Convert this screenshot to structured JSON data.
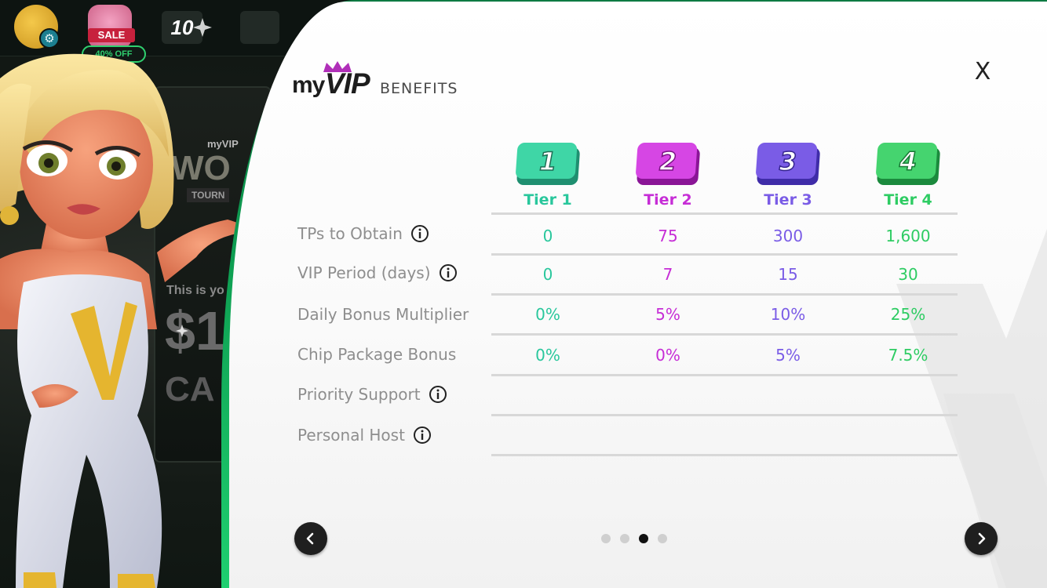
{
  "background": {
    "sale_tag": "SALE",
    "off_tag": "40% OFF",
    "level_badge": "10",
    "promo": {
      "myvip": "myVIP",
      "heading": "WO",
      "tournament": "TOURN",
      "this_is": "This is yo",
      "amount": "$1",
      "ca": "CA"
    }
  },
  "panel": {
    "logo": {
      "my": "my",
      "vip": "VIP",
      "benefits": "BENEFITS"
    },
    "close_label": "X",
    "tiers": [
      {
        "number": "1",
        "label": "Tier 1",
        "color": "#29c79c"
      },
      {
        "number": "2",
        "label": "Tier 2",
        "color": "#c62dd6"
      },
      {
        "number": "3",
        "label": "Tier 3",
        "color": "#7a5ce6"
      },
      {
        "number": "4",
        "label": "Tier 4",
        "color": "#2ecc63"
      }
    ],
    "rows": [
      {
        "label": "TPs to Obtain",
        "info": true,
        "values": [
          "0",
          "75",
          "300",
          "1,600"
        ]
      },
      {
        "label": "VIP Period (days)",
        "info": true,
        "values": [
          "0",
          "7",
          "15",
          "30"
        ]
      },
      {
        "label": "Daily Bonus Multiplier",
        "info": false,
        "values": [
          "0%",
          "5%",
          "10%",
          "25%"
        ]
      },
      {
        "label": "Chip Package Bonus",
        "info": false,
        "values": [
          "0%",
          "0%",
          "5%",
          "7.5%"
        ]
      },
      {
        "label": "Priority Support",
        "info": true,
        "values": [
          "",
          "",
          "",
          ""
        ]
      },
      {
        "label": "Personal Host",
        "info": true,
        "values": [
          "",
          "",
          "",
          ""
        ]
      }
    ],
    "pagination": {
      "total": 4,
      "active_index": 2
    },
    "colors": {
      "frame_green": "#0fa354",
      "divider": "#d8d8d8",
      "label_gray": "#8e8e8e"
    }
  }
}
